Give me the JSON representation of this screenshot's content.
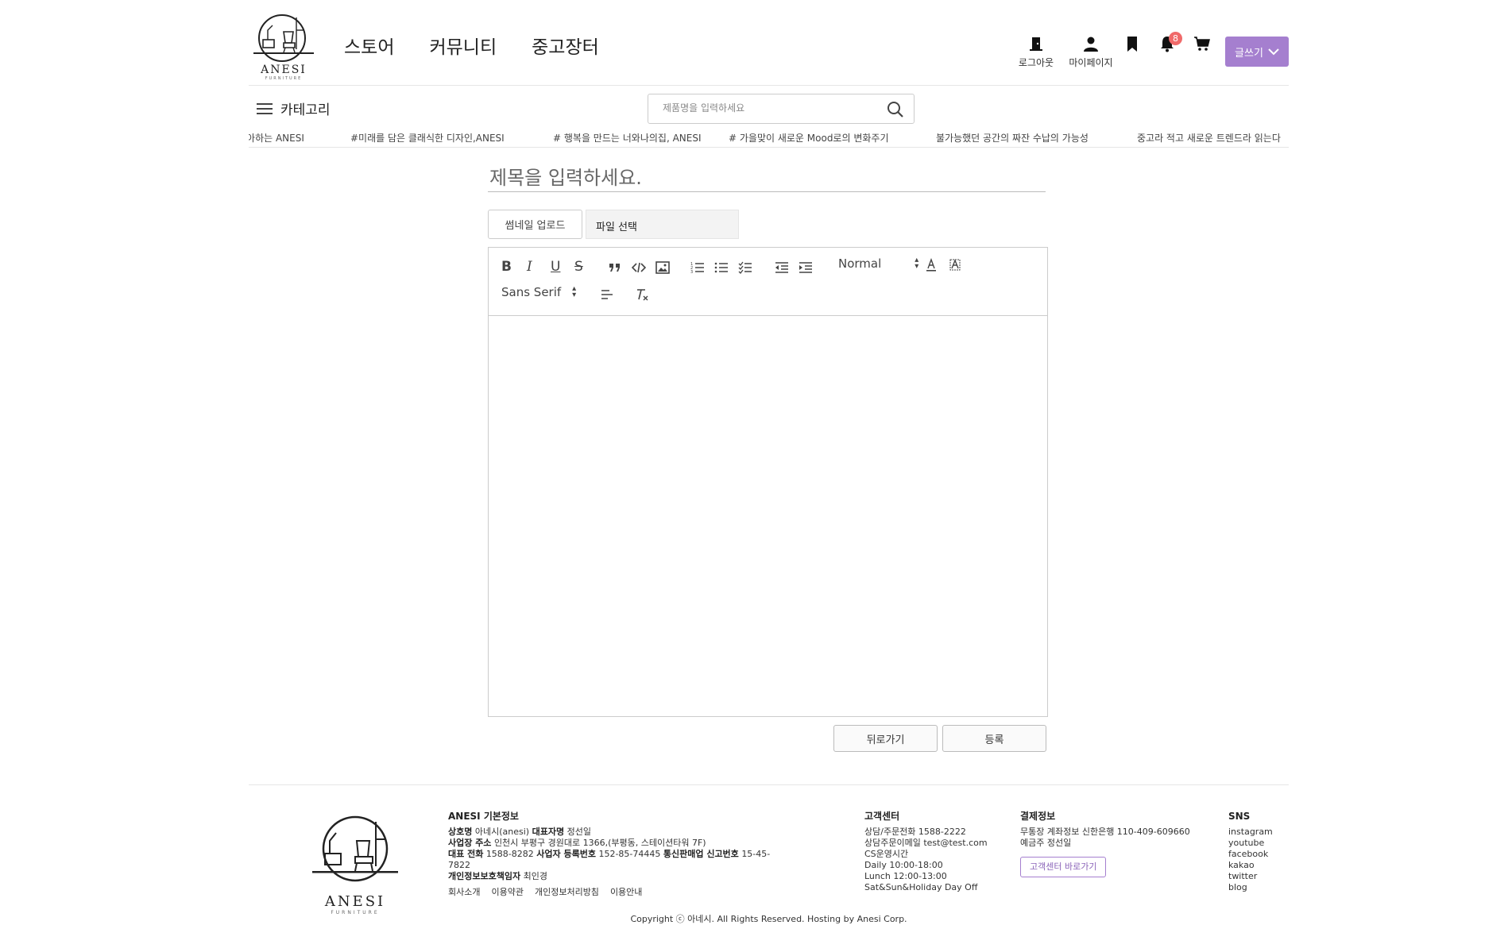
{
  "brand": {
    "logo_text": "ANESI",
    "logo_sub": "FURNITURE"
  },
  "nav": {
    "items": [
      "스토어",
      "커뮤니티",
      "중고장터"
    ]
  },
  "header_icons": {
    "logout_label": "로그아웃",
    "mypage_label": "마이페이지",
    "notification_count": "8",
    "write_label": "글쓰기"
  },
  "subbar": {
    "category_label": "카테고리",
    "search_placeholder": "제품명을 입력하세요"
  },
  "ticker": {
    "items": [
      "좋아하는 ANESI",
      "#미래를 담은 클래식한 디자인,ANESI",
      "# 행복을 만드는 너와나의집, ANESI",
      "# 가을맞이 새로운 Mood로의 변화주기",
      "불가능했던 공간의 짜잔 수납의 가능성",
      "중고라 적고 새로운 트렌드라 읽는다"
    ]
  },
  "editor": {
    "title_placeholder": "제목을 입력하세요.",
    "thumbnail_label": "썸네일 업로드",
    "file_label": "파일 선택",
    "header_select": "Normal",
    "font_select": "Sans Serif",
    "back_label": "뒤로가기",
    "submit_label": "등록"
  },
  "footer": {
    "logo_text": "ANESI",
    "logo_sub": "FURNITURE",
    "info": {
      "title": "ANESI 기본정보",
      "l1_k1": "상호명",
      "l1_v1": "아네시(anesi)",
      "l1_k2": "대표자명",
      "l1_v2": "정선일",
      "l2_k1": "사업장 주소",
      "l2_v1": "인천시 부평구 경원대로 1366,(부평동, 스테이션타워 7F)",
      "l3_k1": "대표 전화",
      "l3_v1": "1588-8282",
      "l3_k2": "사업자 등록번호",
      "l3_v2": "152-85-74445",
      "l3_k3": "통신판매업 신고번호",
      "l3_v3": "15-45-7822",
      "l4_k1": "개인정보보호책임자",
      "l4_v1": "최인경"
    },
    "links": [
      "회사소개",
      "이용약관",
      "개인정보처리방침",
      "이용안내"
    ],
    "cs": {
      "title": "고객센터",
      "lines": [
        "상담/주문전화 1588-2222",
        "상담주문이메일 test@test.com",
        "CS운영시간",
        "Daily 10:00-18:00",
        "Lunch 12:00-13:00",
        "Sat&Sun&Holiday Day Off"
      ]
    },
    "payment": {
      "title": "결제정보",
      "lines": [
        "무통장 계좌정보 신한은행 110-409-609660",
        "예금주 정선일"
      ],
      "cs_button": "고객센터 바로가기"
    },
    "sns": {
      "title": "SNS",
      "items": [
        "instagram",
        "youtube",
        "facebook",
        "kakao",
        "twitter",
        "blog"
      ]
    },
    "copyright": "Copyright ⓒ 아네시. All Rights Reserved. Hosting by Anesi Corp."
  },
  "colors": {
    "accent": "#a57fcf",
    "badge": "#f06a6a"
  }
}
